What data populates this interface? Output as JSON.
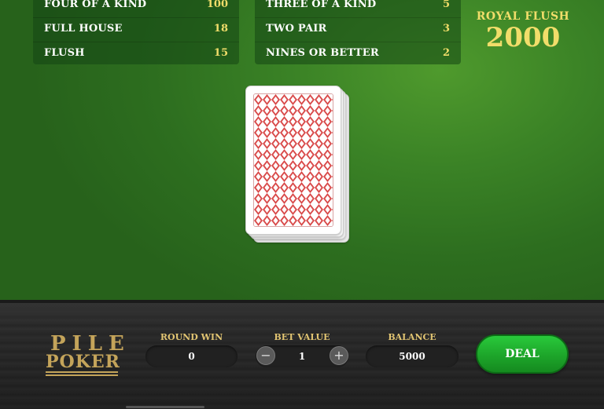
{
  "paytable": {
    "left": [
      {
        "name": "FOUR OF A KIND",
        "value": "100"
      },
      {
        "name": "FULL HOUSE",
        "value": "18"
      },
      {
        "name": "FLUSH",
        "value": "15"
      }
    ],
    "right": [
      {
        "name": "THREE OF A KIND",
        "value": "5"
      },
      {
        "name": "TWO PAIR",
        "value": "3"
      },
      {
        "name": "NINES OR BETTER",
        "value": "2"
      }
    ]
  },
  "royal_flush": {
    "label": "ROYAL FLUSH",
    "value": "2000"
  },
  "logo": {
    "line1": "PILE",
    "line2": "POKER"
  },
  "round_win": {
    "label": "ROUND WIN",
    "value": "0"
  },
  "bet": {
    "label": "BET VALUE",
    "value": "1",
    "minus": "−",
    "plus": "+"
  },
  "balance": {
    "label": "BALANCE",
    "value": "5000"
  },
  "deal_button": {
    "label": "DEAL"
  },
  "colors": {
    "felt": "#3b8326",
    "gold": "#f1dd6a",
    "deal": "#1da52a",
    "card_pattern": "#d94a4a"
  }
}
